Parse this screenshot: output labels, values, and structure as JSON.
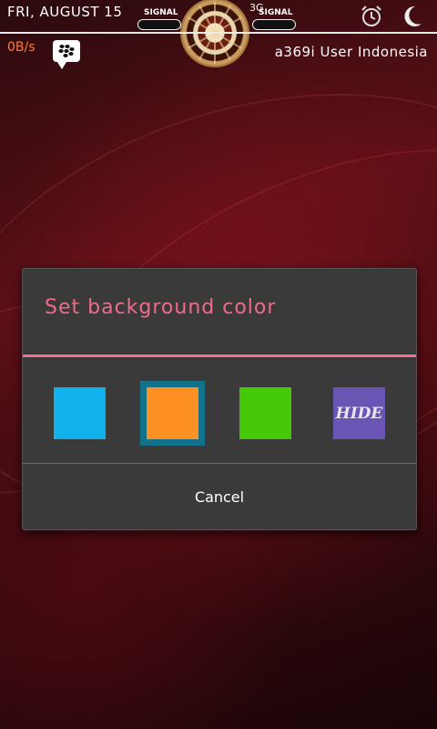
{
  "status": {
    "date": "FRI, AUGUST 15",
    "signal_left_label": "SIGNAL",
    "signal_right_label": "SIGNAL",
    "network": "3G",
    "speed": "0B/s",
    "user": "a369i User Indonesia",
    "signal_left_level": 0.0,
    "signal_right_level": 0.0
  },
  "dialog": {
    "title": "Set background color",
    "cancel_label": "Cancel",
    "swatches": [
      {
        "name": "blue",
        "color": "#0fb2ea",
        "selected": false,
        "label": ""
      },
      {
        "name": "orange",
        "color": "#ff9024",
        "selected": true,
        "label": ""
      },
      {
        "name": "green",
        "color": "#45c808",
        "selected": false,
        "label": ""
      },
      {
        "name": "hide",
        "color": "#6a55b5",
        "selected": false,
        "label": "HIDE"
      }
    ],
    "accent_color": "#f07090"
  },
  "icons": {
    "alarm": "alarm-clock-icon",
    "moon": "moon-icon",
    "bbm": "bbm-chat-icon",
    "clock": "analog-clock-icon"
  }
}
